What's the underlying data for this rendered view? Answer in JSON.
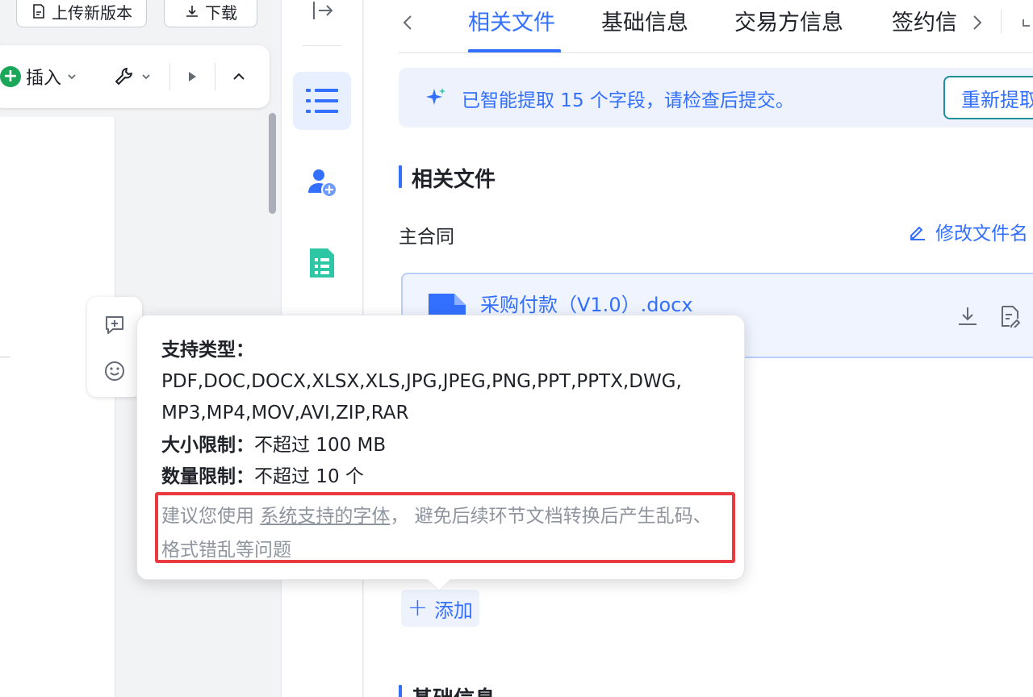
{
  "editor": {
    "upload_label": "上传新版本",
    "download_label": "下载",
    "toolbar": {
      "insert_label": "插入"
    }
  },
  "tabs": [
    {
      "label": "相关文件",
      "active": true
    },
    {
      "label": "基础信息",
      "active": false
    },
    {
      "label": "交易方信息",
      "active": false
    },
    {
      "label": "签约信",
      "active": false
    }
  ],
  "banner": {
    "message": "已智能提取 15 个字段，请检查后提交。",
    "reextract_label": "重新提取"
  },
  "related_files": {
    "section_title": "相关文件",
    "field_label": "主合同",
    "rename_label": "修改文件名",
    "file_name": "采购付款（V1.0）.docx",
    "add_label": "添加"
  },
  "basic_section_title": "基础信息",
  "tooltip": {
    "types_label": "支持类型：",
    "types_line1": "PDF,DOC,DOCX,XLSX,XLS,JPG,JPEG,PNG,PPT,PPTX,DWG,",
    "types_line2": "MP3,MP4,MOV,AVI,ZIP,RAR",
    "size_label": "大小限制：",
    "size_value": "不超过 100 MB",
    "count_label": "数量限制：",
    "count_value": "不超过 10 个",
    "hint_prefix": "建议您使用 ",
    "hint_link": "系统支持的字体",
    "hint_suffix": "， 避免后续环节文档转换后产生乱码、格式错乱等问题"
  },
  "colors": {
    "accent": "#3370ff",
    "highlight": "#e83a3f",
    "insert_green": "#1aa75a",
    "doc_icon_teal": "#2ec7a6"
  }
}
